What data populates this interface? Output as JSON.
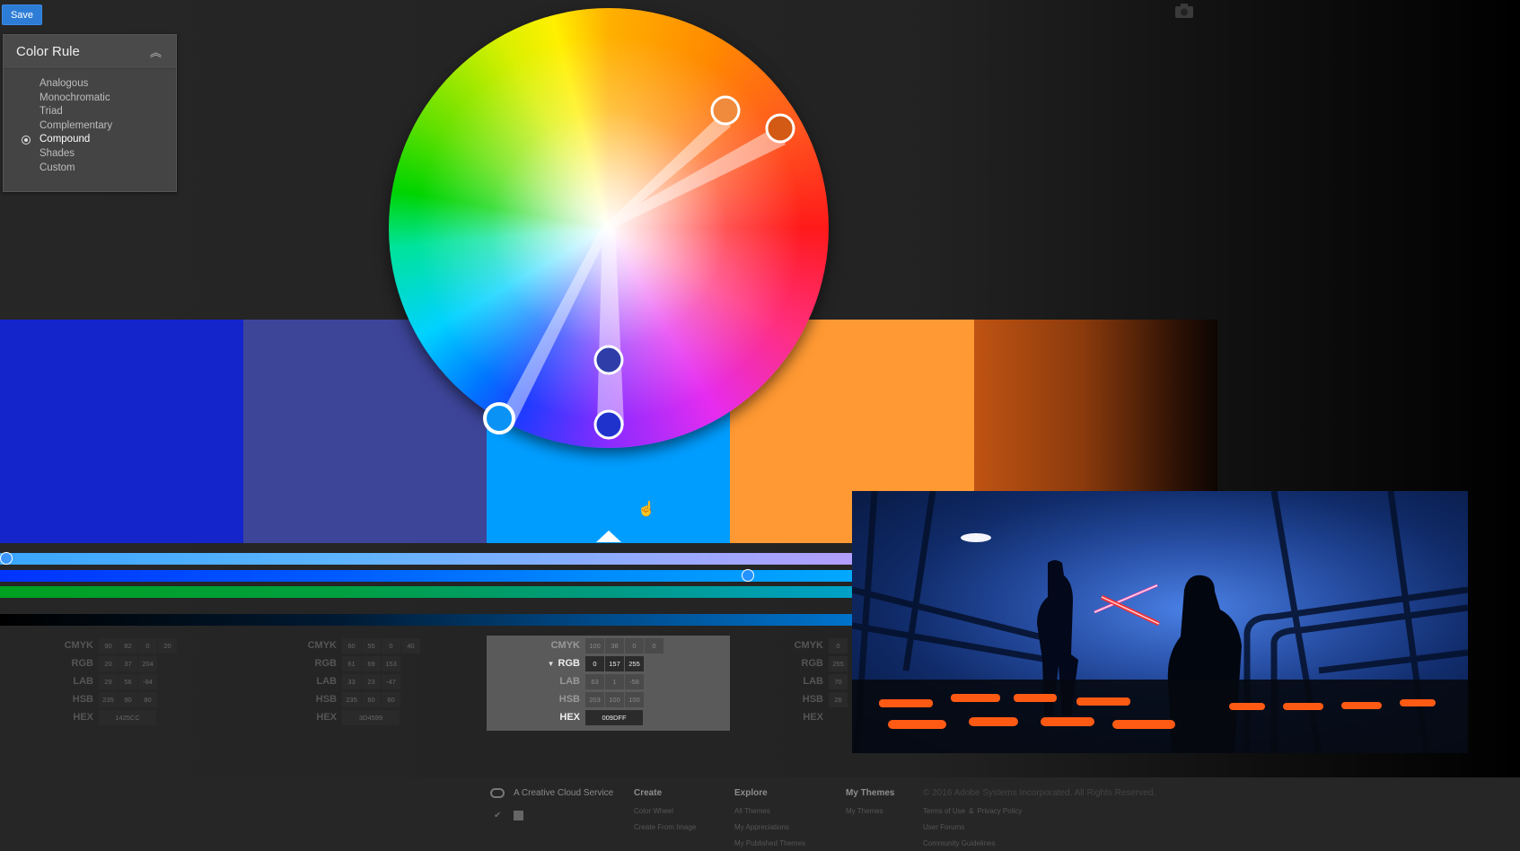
{
  "toolbar": {
    "save_label": "Save"
  },
  "color_rule": {
    "title": "Color Rule",
    "options": [
      "Analogous",
      "Monochromatic",
      "Triad",
      "Complementary",
      "Compound",
      "Shades",
      "Custom"
    ],
    "selected": "Compound"
  },
  "swatches": [
    {
      "hex": "#1425CC"
    },
    {
      "hex": "#3D4599"
    },
    {
      "hex": "#009DFF"
    },
    {
      "hex": "#FF9933"
    },
    {
      "hex": "#BF5313"
    }
  ],
  "values": [
    {
      "cmyk": [
        "90",
        "82",
        "0",
        "20"
      ],
      "rgb": [
        "20",
        "37",
        "204"
      ],
      "lab": [
        "29",
        "56",
        "-84"
      ],
      "hsb": [
        "235",
        "90",
        "80"
      ],
      "hex": "1425CC"
    },
    {
      "cmyk": [
        "60",
        "55",
        "0",
        "40"
      ],
      "rgb": [
        "61",
        "69",
        "153"
      ],
      "lab": [
        "33",
        "23",
        "-47"
      ],
      "hsb": [
        "235",
        "60",
        "60"
      ],
      "hex": "3D4599"
    },
    {
      "cmyk": [
        "100",
        "38",
        "0",
        "0"
      ],
      "rgb": [
        "0",
        "157",
        "255"
      ],
      "lab": [
        "63",
        "1",
        "-58"
      ],
      "hsb": [
        "203",
        "100",
        "100"
      ],
      "hex": "009DFF"
    },
    {
      "cmyk": [
        "0"
      ],
      "rgb": [
        "255"
      ],
      "lab": [
        "70"
      ],
      "hsb": [
        "26"
      ],
      "hex": ""
    }
  ],
  "labels": {
    "cmyk": "CMYK",
    "rgb": "RGB",
    "lab": "LAB",
    "hsb": "HSB",
    "hex": "HEX"
  },
  "footer": {
    "cc_label": "A Creative Cloud Service",
    "create": {
      "title": "Create",
      "links": [
        "Color Wheel",
        "Create From Image"
      ]
    },
    "explore": {
      "title": "Explore",
      "links": [
        "All Themes",
        "My Appreciations",
        "My Published Themes"
      ]
    },
    "my_themes": {
      "title": "My Themes",
      "links": [
        "My Themes"
      ]
    },
    "legal": {
      "copyright": "© 2016 Adobe Systems Incorporated. All Rights Reserved.",
      "links": [
        "Terms of Use",
        "&",
        "Privacy Policy",
        "User Forums",
        "Community Guidelines"
      ]
    }
  },
  "icons": {
    "collapse": "double-chevron-up-icon",
    "camera": "camera-icon",
    "twitter": "twitter-icon",
    "facebook": "facebook-icon",
    "cc_logo": "creative-cloud-icon"
  }
}
